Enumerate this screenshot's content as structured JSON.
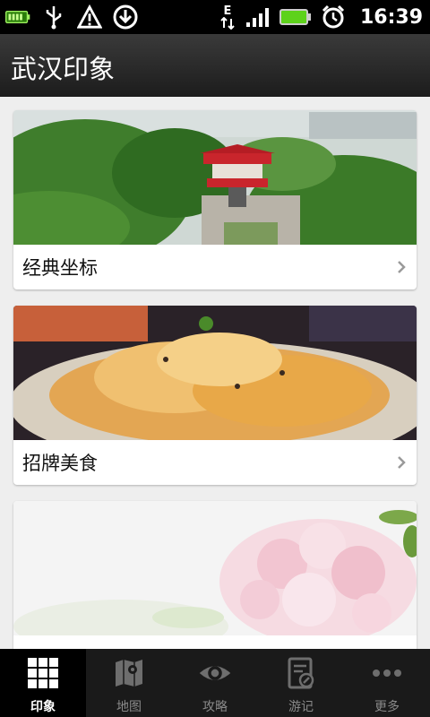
{
  "status_bar": {
    "time": "16:39",
    "network": "E",
    "icons": [
      "battery-charging-icon",
      "usb-icon",
      "warning-icon",
      "download-icon",
      "data-network-icon",
      "signal-icon",
      "battery-icon",
      "alarm-icon"
    ]
  },
  "header": {
    "title": "武汉印象"
  },
  "cards": [
    {
      "title": "经典坐标",
      "image": "landmark-photo"
    },
    {
      "title": "招牌美食",
      "image": "food-photo"
    },
    {
      "title": "",
      "image": "cherry-blossom-photo"
    }
  ],
  "tabs": [
    {
      "label": "印象",
      "icon": "grid-icon",
      "active": true
    },
    {
      "label": "地图",
      "icon": "map-icon",
      "active": false
    },
    {
      "label": "攻略",
      "icon": "eye-icon",
      "active": false
    },
    {
      "label": "游记",
      "icon": "notebook-icon",
      "active": false
    },
    {
      "label": "更多",
      "icon": "more-icon",
      "active": false
    }
  ],
  "colors": {
    "status_bar": "#000000",
    "title_bar": "#2a2a2a",
    "tab_bar": "#1a1a1a",
    "background": "#eeeeee",
    "accent_battery": "#5dd21b"
  }
}
